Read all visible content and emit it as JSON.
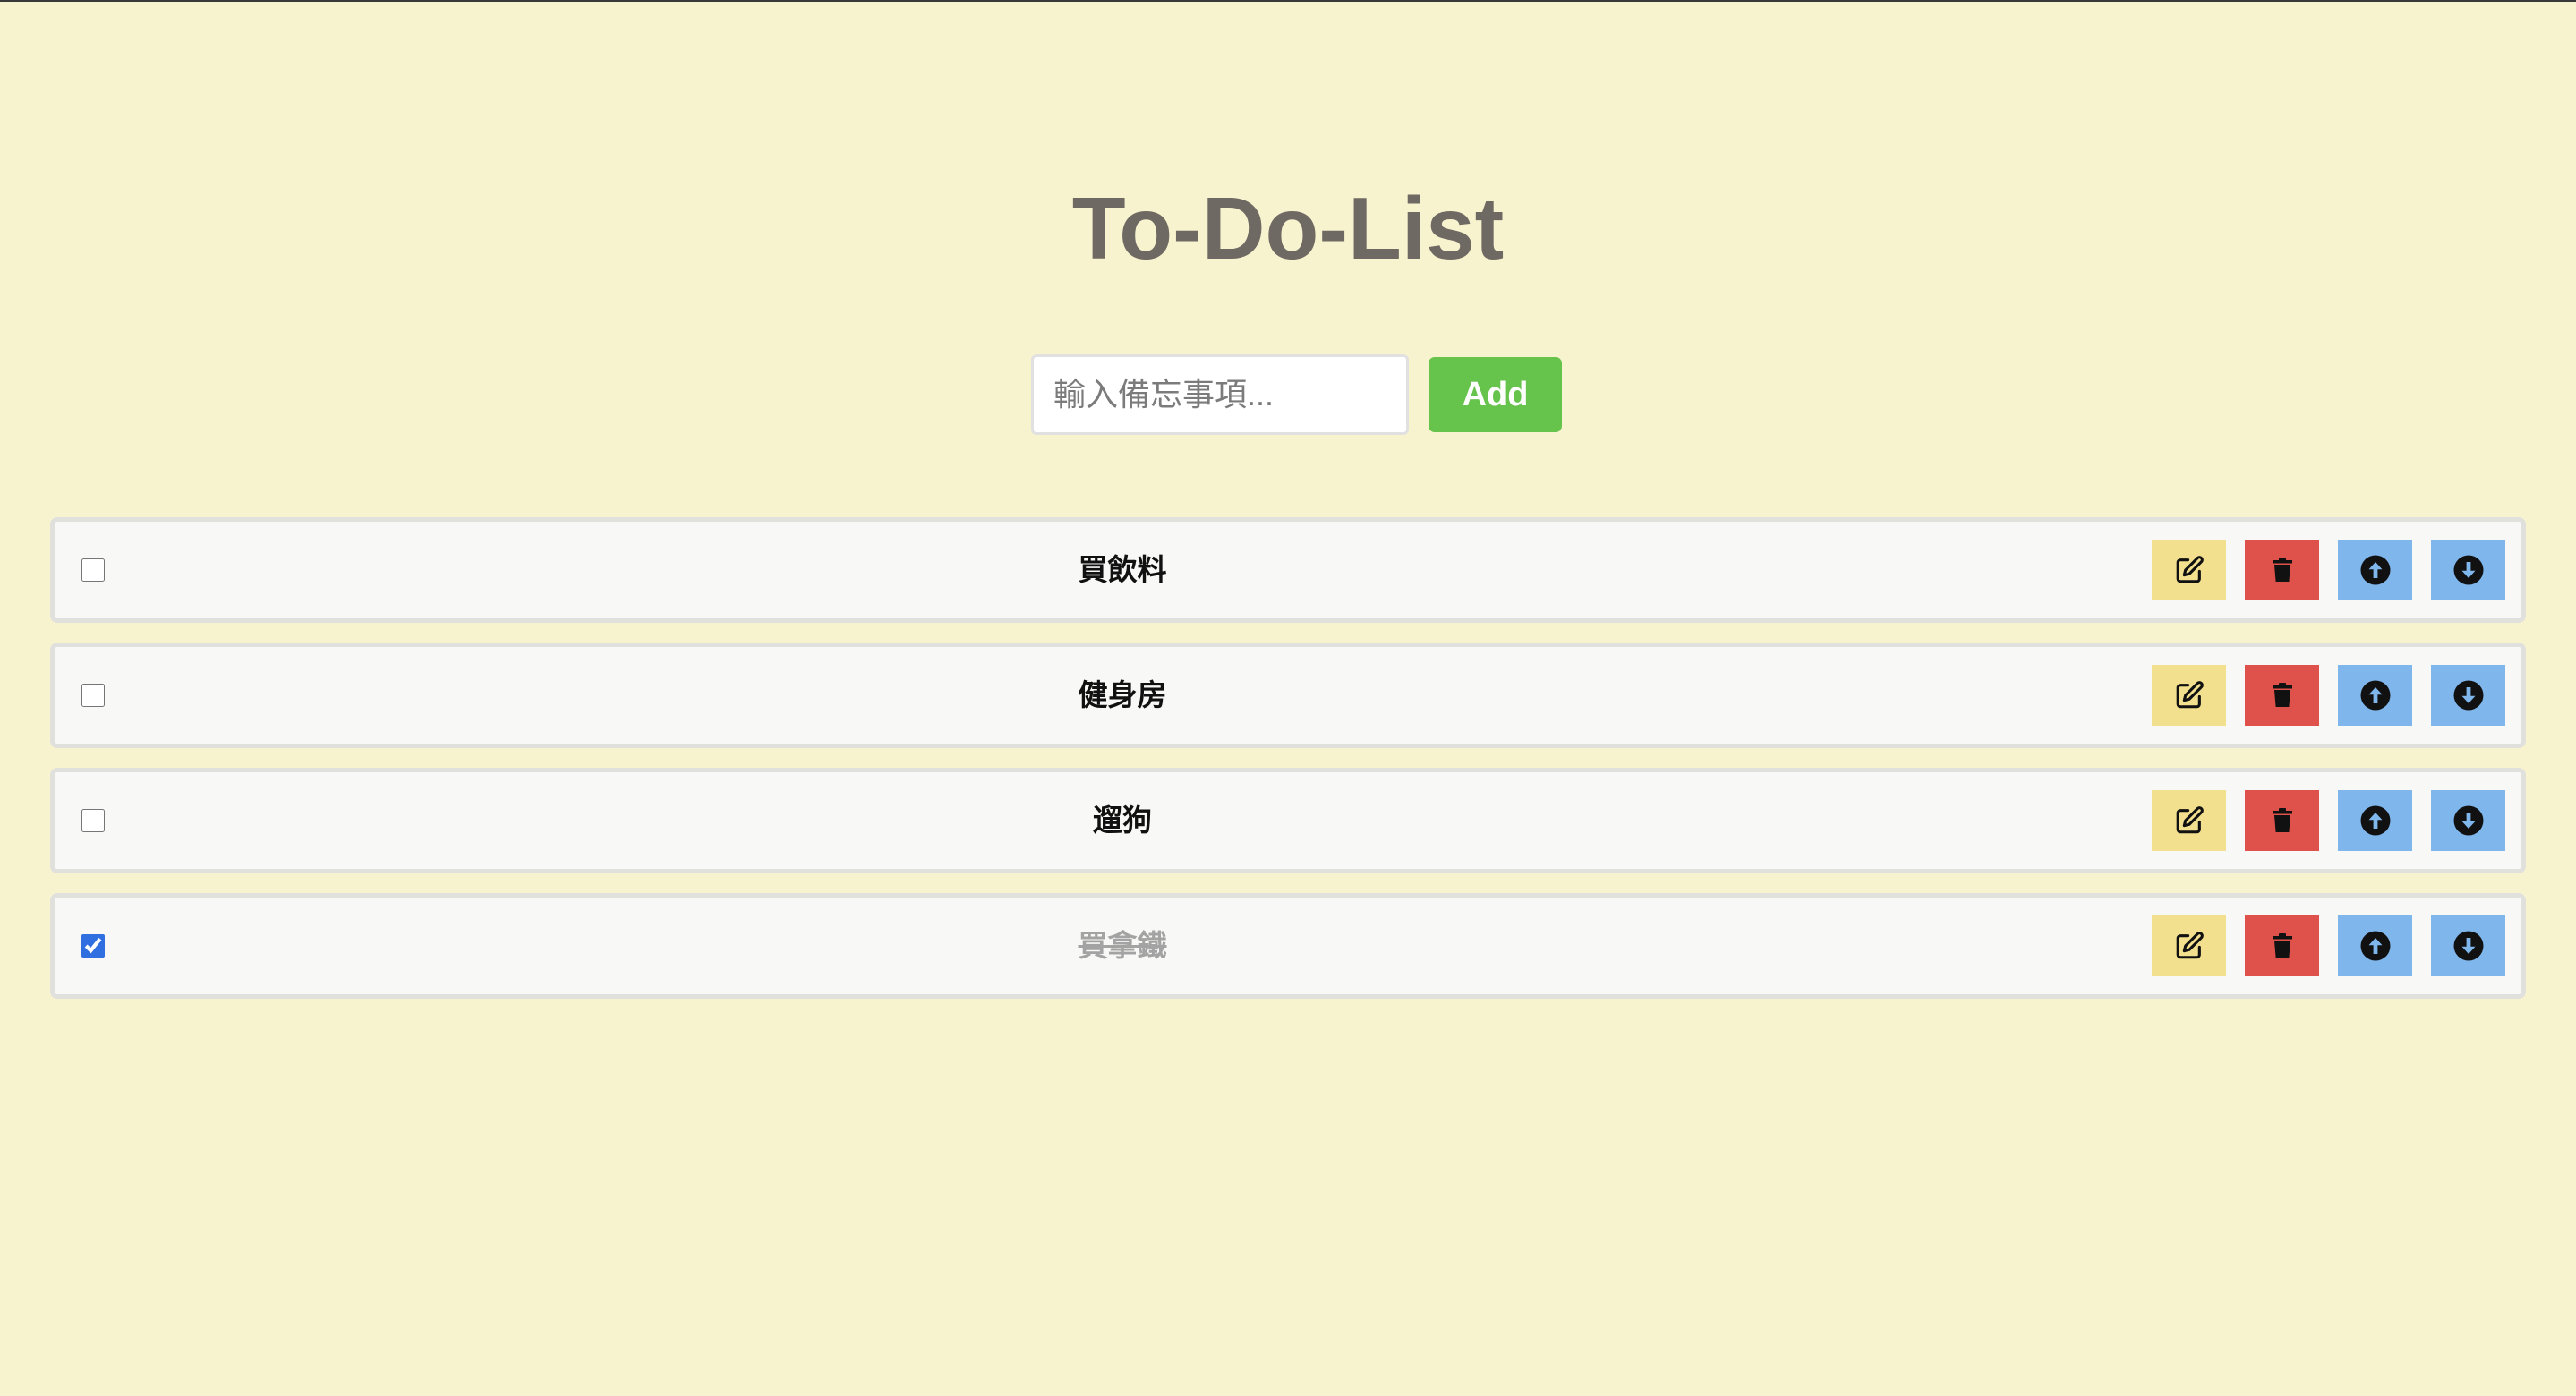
{
  "header": {
    "title": "To-Do-List"
  },
  "form": {
    "placeholder": "輸入備忘事項...",
    "value": "",
    "add_label": "Add"
  },
  "todos": [
    {
      "text": "買飲料",
      "done": false
    },
    {
      "text": "健身房",
      "done": false
    },
    {
      "text": "遛狗",
      "done": false
    },
    {
      "text": "買拿鐵",
      "done": true
    }
  ],
  "icons": {
    "edit": "edit-icon",
    "delete": "trash-icon",
    "up": "arrow-circle-up-icon",
    "down": "arrow-circle-down-icon"
  },
  "colors": {
    "background": "#f8f3cf",
    "title": "#6e6a63",
    "add_button": "#66c34b",
    "edit_button": "#f2e08f",
    "delete_button": "#df524b",
    "move_button": "#7fb6ec",
    "checkbox_checked": "#2f6fe0"
  }
}
